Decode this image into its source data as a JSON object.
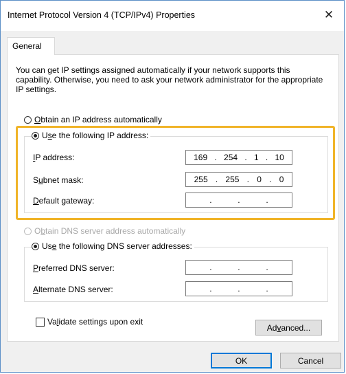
{
  "window": {
    "title": "Internet Protocol Version 4 (TCP/IPv4) Properties",
    "close_glyph": "✕"
  },
  "tabs": [
    {
      "label": "General"
    }
  ],
  "intro_text": "You can get IP settings assigned automatically if your network supports this capability. Otherwise, you need to ask your network administrator for the appropriate IP settings.",
  "ip": {
    "auto": {
      "pre": "",
      "key": "O",
      "post": "btain an IP address automatically",
      "checked": false
    },
    "manual": {
      "pre": "U",
      "key": "s",
      "post": "e the following IP address:",
      "checked": true
    },
    "fields": [
      {
        "pre": "",
        "key": "I",
        "post": "P address:",
        "octets": [
          "169",
          "254",
          "1",
          "10"
        ]
      },
      {
        "pre": "S",
        "key": "u",
        "post": "bnet mask:",
        "octets": [
          "255",
          "255",
          "0",
          "0"
        ]
      },
      {
        "pre": "",
        "key": "D",
        "post": "efault gateway:",
        "octets": [
          "",
          "",
          "",
          ""
        ]
      }
    ]
  },
  "dns": {
    "auto": {
      "pre": "O",
      "key": "b",
      "post": "tain DNS server address automatically",
      "checked": false,
      "disabled": true
    },
    "manual": {
      "pre": "Us",
      "key": "e",
      "post": " the following DNS server addresses:",
      "checked": true
    },
    "fields": [
      {
        "pre": "",
        "key": "P",
        "post": "referred DNS server:",
        "octets": [
          "",
          "",
          "",
          ""
        ]
      },
      {
        "pre": "",
        "key": "A",
        "post": "lternate DNS server:",
        "octets": [
          "",
          "",
          "",
          ""
        ]
      }
    ]
  },
  "validate": {
    "pre": "Va",
    "key": "l",
    "post": "idate settings upon exit",
    "checked": false
  },
  "buttons": {
    "advanced": {
      "pre": "Ad",
      "key": "v",
      "post": "anced..."
    },
    "ok": "OK",
    "cancel": "Cancel"
  },
  "colors": {
    "highlight": "#f0b429",
    "default_button_border": "#0078d7"
  }
}
